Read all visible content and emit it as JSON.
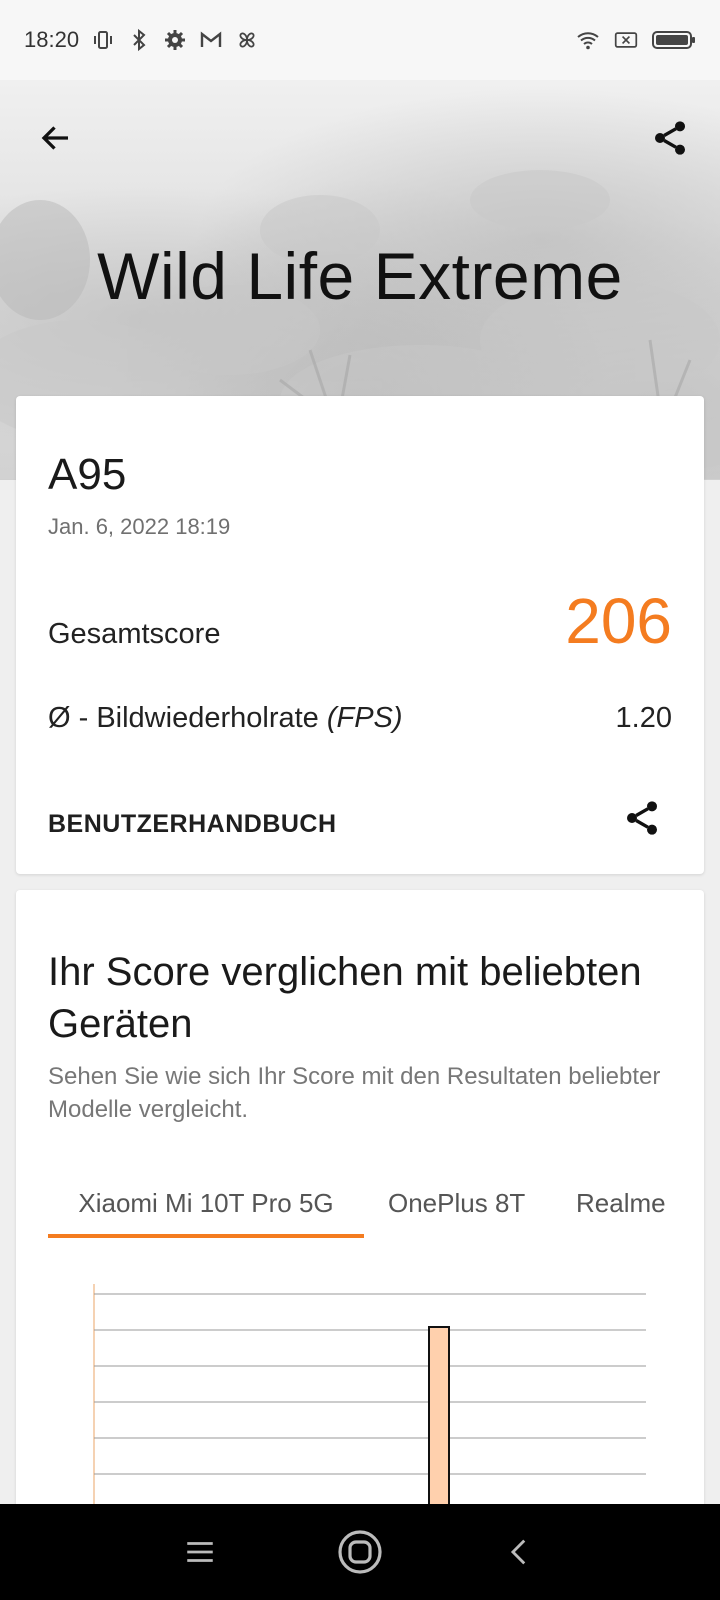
{
  "status_bar": {
    "time": "18:20",
    "left_icons": [
      "vibrate-icon",
      "bluetooth-icon",
      "settings-icon",
      "gmail-icon",
      "pinwheel-icon"
    ],
    "right_icons": [
      "wifi-icon",
      "sim-off-icon",
      "battery-icon"
    ]
  },
  "header": {
    "title": "Wild Life Extreme",
    "back_icon": "arrow-left-icon",
    "share_icon": "share-icon"
  },
  "result_card": {
    "device": "A95",
    "date": "Jan. 6, 2022 18:19",
    "score_label": "Gesamtscore",
    "score_value": "206",
    "fps_label_main": "Ø - Bildwiederholrate ",
    "fps_label_unit": "(FPS)",
    "fps_value": "1.20",
    "manual_label": "BENUTZERHANDBUCH",
    "share_icon": "share-icon",
    "accent_color": "#f47c20"
  },
  "comparison_card": {
    "title": "Ihr Score verglichen mit beliebten Geräten",
    "subtitle": "Sehen Sie wie sich Ihr Score mit den Resultaten beliebter Modelle vergleicht.",
    "tabs": [
      {
        "label": "Xiaomi Mi 10T Pro 5G",
        "active": true
      },
      {
        "label": "OnePlus 8T",
        "active": false
      },
      {
        "label": "Realme",
        "active": false
      }
    ]
  },
  "chart_data": {
    "type": "bar",
    "title": "",
    "xlabel": "",
    "ylabel": "",
    "grid": true,
    "highlight_color": "#ffd0ad",
    "series": [
      {
        "values": [
          0,
          0,
          0,
          0,
          0,
          0,
          0,
          0.9,
          0,
          0,
          0,
          0
        ]
      }
    ],
    "ylim": [
      0,
      1
    ]
  },
  "nav_bar": {
    "icons": [
      "menu-icon",
      "home-icon",
      "back-icon"
    ]
  }
}
